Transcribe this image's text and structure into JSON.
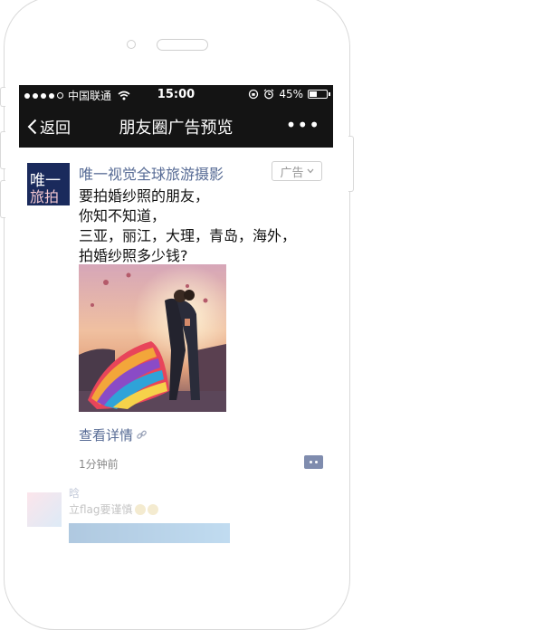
{
  "status_bar": {
    "carrier": "中国联通",
    "time": "15:00",
    "battery": "45%",
    "battery_level": 0.45
  },
  "nav": {
    "back_label": "返回",
    "title": "朋友圈广告预览",
    "more_label": "•••"
  },
  "ad_post": {
    "avatar_line1": "唯一",
    "avatar_line2": "旅拍",
    "author": "唯一视觉全球旅游摄影",
    "ad_label": "广告",
    "text_lines": [
      "要拍婚纱照的朋友，",
      "你知不知道，",
      "三亚，丽江，大理，青岛，海外，",
      "拍婚纱照多少钱?"
    ],
    "detail_link": "查看详情",
    "time_ago": "1分钟前"
  },
  "next_post": {
    "name": "晗",
    "text": "立flag要谨慎"
  },
  "colors": {
    "bar_bg": "#141414",
    "link_blue": "#576b95",
    "avatar_bg": "#1a2a5c"
  }
}
